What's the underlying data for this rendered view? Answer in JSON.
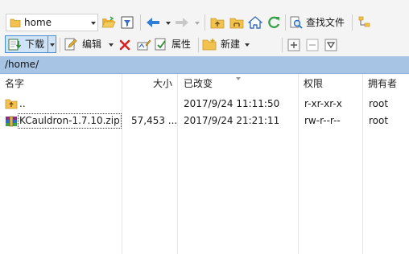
{
  "toolbar1": {
    "location_value": "home",
    "find_files_label": "查找文件"
  },
  "toolbar2": {
    "download_label": "下载",
    "edit_label": "编辑",
    "properties_label": "属性",
    "new_label": "新建"
  },
  "path": "/home/",
  "columns": {
    "name": "名字",
    "size": "大小",
    "modified": "已改变",
    "permissions": "权限",
    "owner": "拥有者"
  },
  "files": [
    {
      "name": "..",
      "size": "",
      "modified": "2017/9/24 11:11:50",
      "permissions": "r-xr-xr-x",
      "owner": "root",
      "icon": "parent-folder-icon"
    },
    {
      "name": "KCauldron-1.7.10.zip",
      "size": "57,453 ...",
      "modified": "2017/9/24 21:21:11",
      "permissions": "rw-r--r--",
      "owner": "root",
      "icon": "zip-archive-icon"
    }
  ],
  "colors": {
    "path_bar": "#a8c4e4",
    "download_button_bg": "#cfe3f7",
    "download_button_border": "#4a8fd6",
    "folder": "#f2c14e",
    "back_arrow": "#2f7fd8",
    "refresh": "#3aa34a",
    "delete": "#d42020"
  }
}
